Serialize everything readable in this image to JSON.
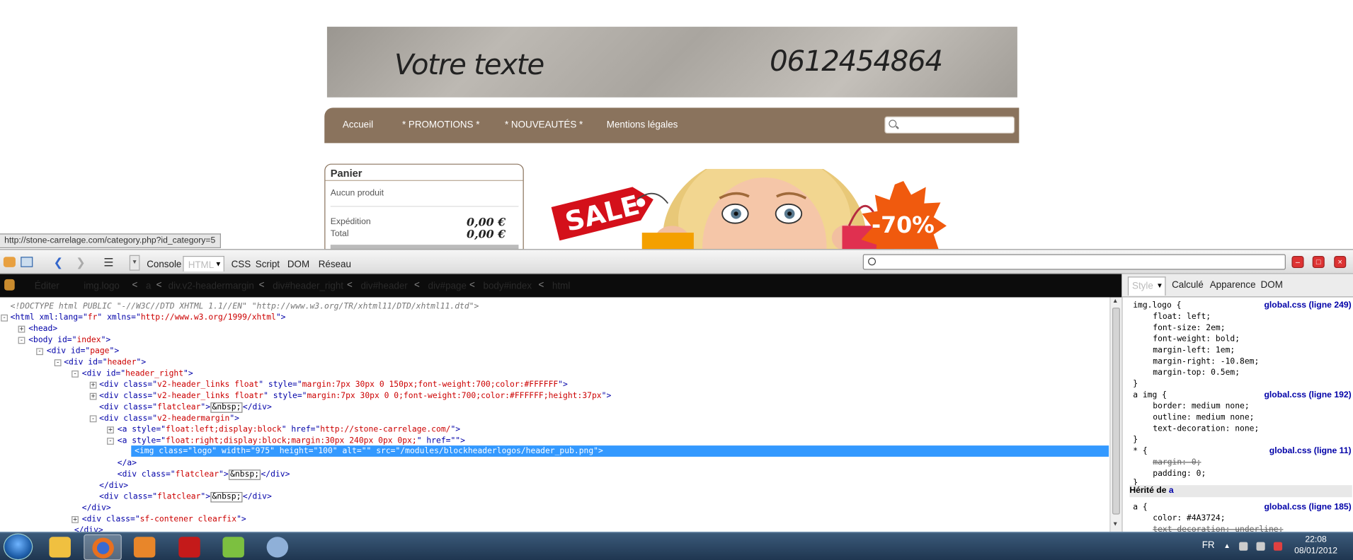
{
  "site": {
    "banner": {
      "text": "Votre texte",
      "phone": "0612454864"
    },
    "nav": [
      {
        "label": "Accueil"
      },
      {
        "label": "* PROMOTIONS *"
      },
      {
        "label": "* NOUVEAUTÉS *"
      },
      {
        "label": "Mentions légales"
      }
    ],
    "search": {
      "placeholder": ""
    },
    "panier": {
      "title": "Panier",
      "empty_text": "Aucun produit",
      "shipping_label": "Expédition",
      "shipping_value": "0,00 €",
      "total_label": "Total",
      "total_value": "0,00 €"
    },
    "promo": {
      "sale_text": "SALE",
      "discount_text": "-70%"
    },
    "status_url": "http://stone-carrelage.com/category.php?id_category=5"
  },
  "firebug": {
    "tabs": {
      "console": "Console",
      "html": "HTML",
      "css": "CSS",
      "script": "Script",
      "dom": "DOM",
      "network": "Réseau"
    },
    "breadcrumbs": [
      "Éditer",
      "img.logo",
      "a",
      "div.v2-headermargin",
      "div#header_right",
      "div#header",
      "div#page",
      "body#index",
      "html"
    ],
    "side_tabs": {
      "style": "Style",
      "computed": "Calculé",
      "layout": "Apparence",
      "dom": "DOM"
    },
    "html_lines": {
      "doctype": "<!DOCTYPE html PUBLIC \"-//W3C//DTD XHTML 1.1//EN\" \"http://www.w3.org/TR/xhtml11/DTD/xhtml11.dtd\">",
      "l_html_a": "<html xml:lang=\"",
      "l_html_b": "fr",
      "l_html_c": "\" xmlns=\"",
      "l_html_d": "http://www.w3.org/1999/xhtml",
      "l_html_e": "\">",
      "l_head": "<head>",
      "l_body_a": "<body id=\"",
      "l_body_b": "index",
      "l_body_c": "\">",
      "l_page_a": "<div id=\"",
      "l_page_b": "page",
      "l_page_c": "\">",
      "l_header_a": "<div id=\"",
      "l_header_b": "header",
      "l_header_c": "\">",
      "l_hr_a": "<div id=\"",
      "l_hr_b": "header_right",
      "l_hr_c": "\">",
      "l_links1_a": "<div class=\"",
      "l_links1_b": "v2-header_links float",
      "l_links1_c": "\" style=\"",
      "l_links1_d": "margin:7px 30px 0 150px;font-weight:700;color:#FFFFFF",
      "l_links1_e": "\">",
      "l_links2_a": "<div class=\"",
      "l_links2_b": "v2-header_links floatr",
      "l_links2_c": "\" style=\"",
      "l_links2_d": "margin:7px 30px 0 0;font-weight:700;color:#FFFFFF;height:37px",
      "l_links2_e": "\">",
      "l_fc1_a": "<div class=\"",
      "l_fc1_b": "flatclear",
      "l_fc1_c": "\">",
      "l_fc1_ent": "&nbsp;",
      "l_fc1_d": "</div>",
      "l_hm_a": "<div class=\"",
      "l_hm_b": "v2-headermargin",
      "l_hm_c": "\">",
      "l_a1_a": "<a style=\"",
      "l_a1_b": "float:left;display:block",
      "l_a1_c": "\" href=\"",
      "l_a1_d": "http://stone-carrelage.com/",
      "l_a1_e": "\">",
      "l_a2_a": "<a style=\"",
      "l_a2_b": "float:right;display:block;margin:30px 240px 0px 0px;",
      "l_a2_c": "\" href=\"",
      "l_a2_d": "",
      "l_a2_e": "\">",
      "l_img": "<img class=\"logo\" width=\"975\" height=\"100\" alt=\"\" src=\"/modules/blockheaderlogos/header_pub.png\">",
      "l_aclose": "</a>",
      "l_fc2_a": "<div class=\"",
      "l_fc2_b": "flatclear",
      "l_fc2_c": "\">",
      "l_fc2_ent": "&nbsp;",
      "l_fc2_d": "</div>",
      "l_divclose1": "</div>",
      "l_fc3_a": "<div class=\"",
      "l_fc3_b": "flatclear",
      "l_fc3_c": "\">",
      "l_fc3_ent": "&nbsp;",
      "l_fc3_d": "</div>",
      "l_divclose2": "</div>",
      "l_sf_a": "<div class=\"",
      "l_sf_b": "sf-contener clearfix",
      "l_sf_c": "\">",
      "l_divclose3": "</div>"
    },
    "styles": {
      "r1_sel": "img.logo {",
      "r1_src": "global.css (ligne 249)",
      "r1_p1": "float: left;",
      "r1_p2": "font-size: 2em;",
      "r1_p3": "font-weight: bold;",
      "r1_p4": "margin-left: 1em;",
      "r1_p5": "margin-right: -10.8em;",
      "r1_p6": "margin-top: 0.5em;",
      "r1_close": "}",
      "r2_sel": "a img {",
      "r2_src": "global.css (ligne 192)",
      "r2_p1": "border: medium none;",
      "r2_p2": "outline: medium none;",
      "r2_p3": "text-decoration: none;",
      "r2_close": "}",
      "r3_sel": "* {",
      "r3_src": "global.css (ligne 11)",
      "r3_p1": "margin: 0;",
      "r3_p2": "padding: 0;",
      "r3_close": "}",
      "inherit_label": "Hérité de",
      "inherit_el": "a",
      "r4_sel": "a {",
      "r4_src": "global.css (ligne 185)",
      "r4_p1": "color: #4A3724;",
      "r4_p2": "text-decoration: underline;"
    }
  },
  "taskbar": {
    "language": "FR",
    "time": "22:08",
    "date": "08/01/2012",
    "apps": [
      "windows-explorer-icon",
      "firefox-icon",
      "sass-icon",
      "filezilla-icon",
      "notepad-icon",
      "paint-icon"
    ]
  },
  "colors": {
    "nav_bg": "#8a735d",
    "selection": "#3399ff",
    "attr_value": "#cc0000",
    "tag": "#0000a8"
  }
}
